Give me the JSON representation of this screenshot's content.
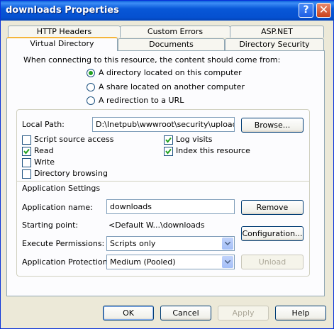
{
  "window": {
    "title": "downloads Properties"
  },
  "tabs": {
    "row_back": [
      "HTTP Headers",
      "Custom Errors",
      "ASP.NET"
    ],
    "row_front": [
      "Virtual Directory",
      "Documents",
      "Directory Security"
    ],
    "active": "Virtual Directory"
  },
  "content_source": {
    "prompt": "When connecting to this resource, the content should come from:",
    "options": [
      {
        "label": "A directory located on this computer",
        "selected": true
      },
      {
        "label": "A share located on another computer",
        "selected": false
      },
      {
        "label": "A redirection to a URL",
        "selected": false
      }
    ]
  },
  "local_path": {
    "label": "Local Path:",
    "value": "D:\\Inetpub\\wwwroot\\security\\uploads",
    "browse_label": "Browse..."
  },
  "permissions": {
    "script_source_access": {
      "label": "Script source access",
      "checked": false
    },
    "read": {
      "label": "Read",
      "checked": true
    },
    "write": {
      "label": "Write",
      "checked": false
    },
    "directory_browsing": {
      "label": "Directory browsing",
      "checked": false
    },
    "log_visits": {
      "label": "Log visits",
      "checked": true
    },
    "index_resource": {
      "label": "Index this resource",
      "checked": true
    }
  },
  "app_settings": {
    "heading": "Application Settings",
    "app_name_label": "Application name:",
    "app_name_value": "downloads",
    "remove_label": "Remove",
    "starting_point_label": "Starting point:",
    "starting_point_value": "<Default W...\\downloads",
    "configuration_label": "Configuration...",
    "exec_perm_label": "Execute Permissions:",
    "exec_perm_value": "Scripts only",
    "app_protection_label": "Application Protection:",
    "app_protection_value": "Medium (Pooled)",
    "unload_label": "Unload"
  },
  "footer": {
    "ok": "OK",
    "cancel": "Cancel",
    "apply": "Apply",
    "help": "Help"
  },
  "colors": {
    "titlebar": "#0858d8",
    "dialog_bg": "#ece9d8",
    "active_tab_accent": "#f5b53a",
    "check_green": "#21a121"
  },
  "icons": {
    "help": "question-mark",
    "close": "x-mark"
  }
}
